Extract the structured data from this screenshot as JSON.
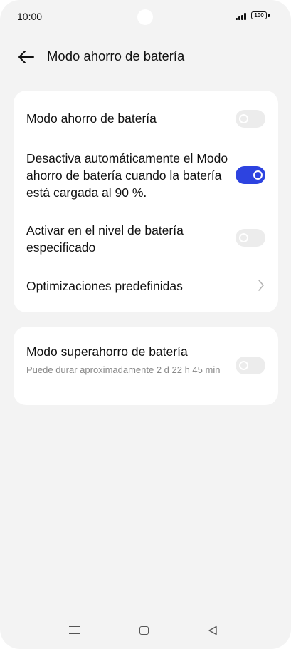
{
  "status_bar": {
    "time": "10:00",
    "battery": "100"
  },
  "header": {
    "title": "Modo ahorro de batería"
  },
  "settings": [
    {
      "label": "Modo ahorro de batería",
      "toggle": "off"
    },
    {
      "label": "Desactiva automáticamente el Modo ahorro de batería cuando la batería está cargada al 90 %.",
      "toggle": "on"
    },
    {
      "label": "Activar en el nivel de batería especificado",
      "toggle": "off"
    },
    {
      "label": "Optimizaciones predefinidas"
    }
  ],
  "super_saver": {
    "label": "Modo superahorro de batería",
    "subtitle": "Puede durar aproximadamente 2 d 22 h 45 min",
    "toggle": "off"
  },
  "colors": {
    "accent": "#2d43e0",
    "background": "#f3f3f3"
  }
}
